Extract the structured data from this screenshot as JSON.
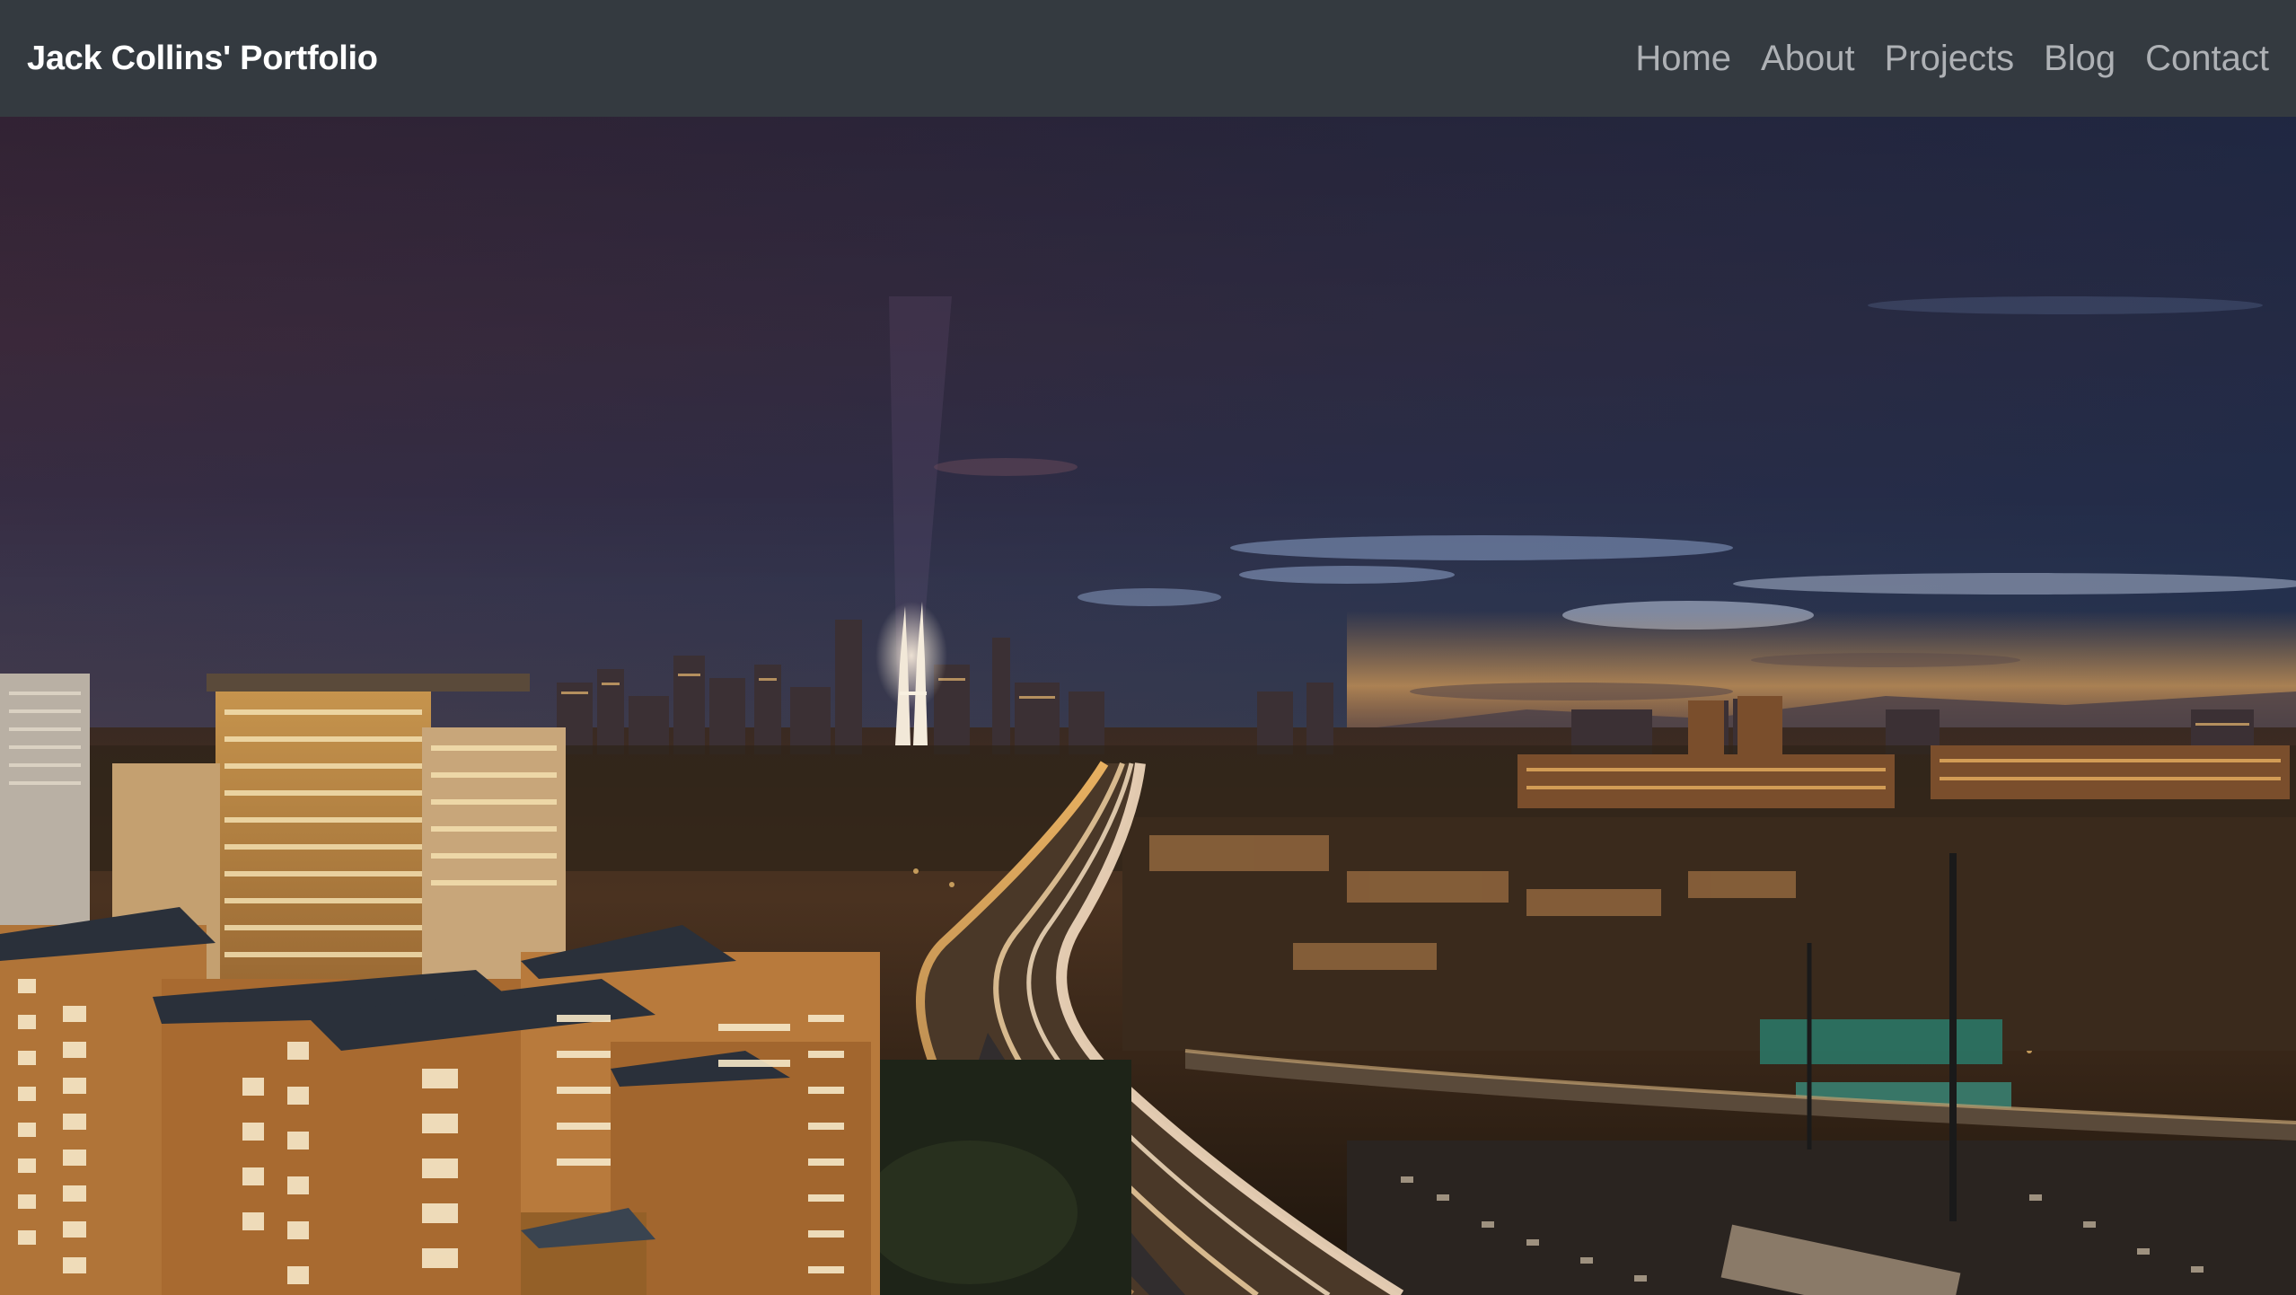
{
  "navbar": {
    "brand": "Jack Collins' Portfolio",
    "links": [
      "Home",
      "About",
      "Projects",
      "Blog",
      "Contact"
    ]
  },
  "colors": {
    "navbar_bg": "#343a40",
    "brand_text": "#ffffff",
    "link_text": "#aeb1b5"
  },
  "hero": {
    "image": "night-city-skyline"
  }
}
